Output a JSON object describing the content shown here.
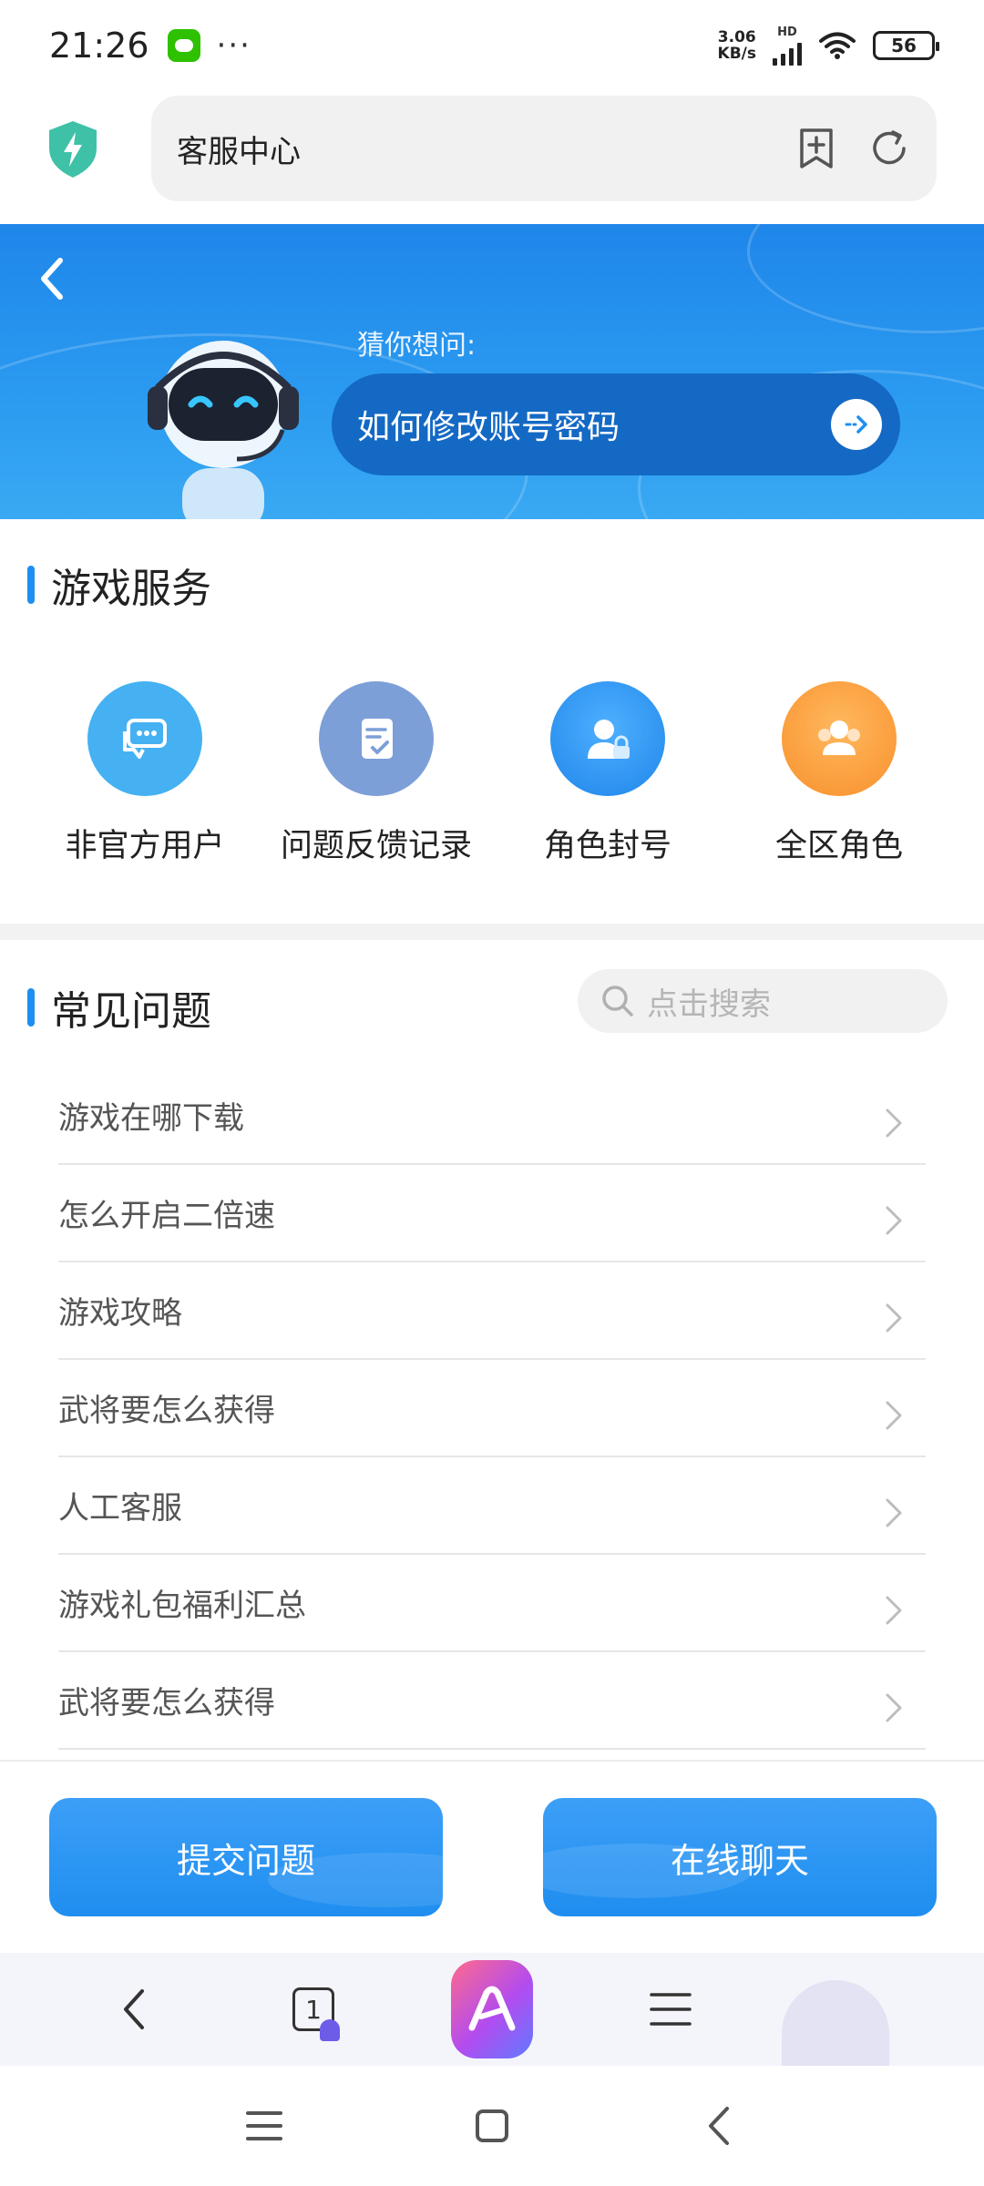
{
  "status_bar": {
    "time": "21:26",
    "more": "···",
    "net_speed_value": "3.06",
    "net_speed_unit": "KB/s",
    "hd": "HD",
    "battery": "56"
  },
  "address_bar": {
    "url_text": "客服中心"
  },
  "hero": {
    "hint_label": "猜你想问:",
    "hint_question": "如何修改账号密码"
  },
  "game_services": {
    "title": "游戏服务",
    "items": [
      {
        "label": "非官方用户",
        "icon": "chat-bubbles-icon",
        "color": "#45b1f2"
      },
      {
        "label": "问题反馈记录",
        "icon": "document-check-icon",
        "color": "#7d9fd8"
      },
      {
        "label": "角色封号",
        "icon": "user-lock-icon",
        "color": "#2a92ee"
      },
      {
        "label": "全区角色",
        "icon": "user-group-icon",
        "color": "#f8993a"
      }
    ]
  },
  "faq": {
    "title": "常见问题",
    "search_placeholder": "点击搜索",
    "items": [
      "游戏在哪下载",
      "怎么开启二倍速",
      "游戏攻略",
      "武将要怎么获得",
      "人工客服",
      "游戏礼包福利汇总",
      "武将要怎么获得"
    ]
  },
  "actions": {
    "submit_label": "提交问题",
    "chat_label": "在线聊天"
  },
  "browser_toolbar": {
    "tab_count": "1"
  },
  "colors": {
    "accent": "#1e8ff0",
    "hero_pill": "#1469c4"
  }
}
